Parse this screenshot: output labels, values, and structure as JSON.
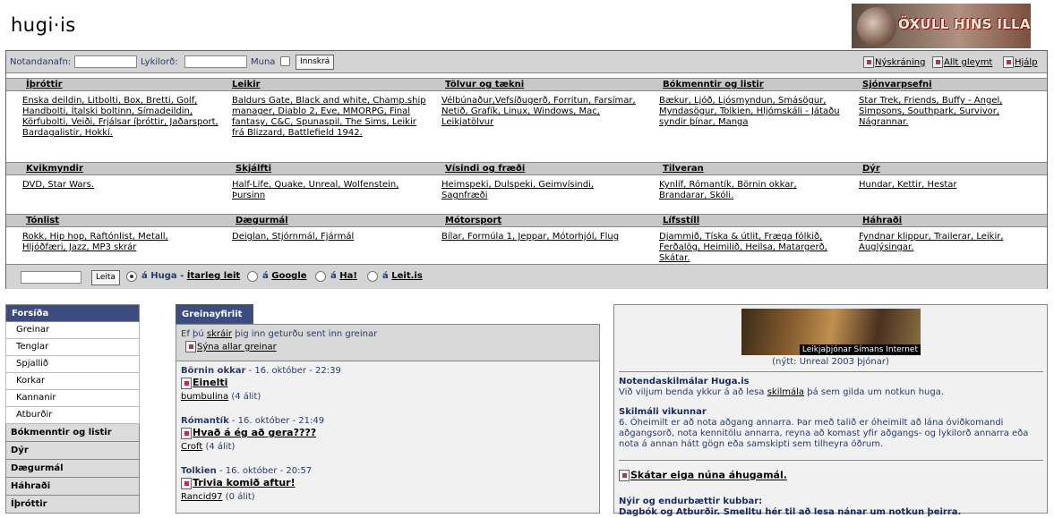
{
  "site": {
    "logo": "hugi·is",
    "banner_text": "ÖXULL HINS ILLA"
  },
  "login": {
    "username_label": "Notandanafn:",
    "password_label": "Lykilorð:",
    "remember_label": "Muna",
    "login_button": "Innskrá",
    "links": [
      "Nýskráning",
      "Allt gleymt",
      "Hjálp"
    ]
  },
  "categories": {
    "row1": [
      {
        "head": "Íþróttir",
        "body": "Enska deildin, Litbolti, Box, Bretti, Golf, Handbolti, Ítalski boltinn, Símadeildin, Körfubolti, Veiði, Frjálsar íþróttir, Jaðarsport, Bardagalistir, Hokkí."
      },
      {
        "head": "Leikir",
        "body": "Baldurs Gate, Black and white, Champ.ship manager, Diablo 2, Eve, MMORPG, Final fantasy, C&C, Spunaspil, The Sims, Leikir frá Blizzard, Battlefield 1942."
      },
      {
        "head": "Tölvur og tækni",
        "body": "Vélbúnaður,Vefsíðugerð, Forritun, Farsímar, Netið, Grafík, Linux, Windows, Mac, Leikjatölvur"
      },
      {
        "head": "Bókmenntir og listir",
        "body": "Bækur, Ljóð, Ljósmyndun, Smásögur, Myndasögur, Tolkien, Hljómskáli - Játaðu syndir þínar, Manga"
      },
      {
        "head": "Sjónvarpsefni",
        "body": "Star Trek, Friends, Buffy - Angel, Simpsons, Southpark, Survivor, Nágrannar."
      }
    ],
    "row2": [
      {
        "head": "Kvikmyndir",
        "body": "DVD, Star Wars."
      },
      {
        "head": "Skjálfti",
        "body": "Half-Life, Quake, Unreal, Wolfenstein, Þursinn"
      },
      {
        "head": "Vísindi og fræði",
        "body": "Heimspeki, Dulspeki, Geimvísindi, Sagnfræði"
      },
      {
        "head": "Tilveran",
        "body": "Kynlíf, Rómantík, Börnin okkar, Brandarar, Skóli."
      },
      {
        "head": "Dýr",
        "body": "Hundar, Kettir, Hestar"
      }
    ],
    "row3": [
      {
        "head": "Tónlist",
        "body": "Rokk, Hip hop, Raftónlist, Metall, Hljóðfæri, Jazz, MP3 skrár"
      },
      {
        "head": "Dægurmál",
        "body": "Deiglan, Stjórnmál, Fjármál"
      },
      {
        "head": "Mótorsport",
        "body": "Bílar, Formúla 1, Jeppar, Mótorhjól, Flug"
      },
      {
        "head": "Lífsstíll",
        "body": "Djammið, Tíska & útlit, Fræga fólkið, Ferðalög, Heimilið, Heilsa, Matargerð, Skátar."
      },
      {
        "head": "Háhraði",
        "body": "Fyndnar klippur, Trailerar, Leikir, Auglýsingar."
      }
    ]
  },
  "search": {
    "button": "Leita",
    "opt1_prefix": "á",
    "opt1": "Huga",
    "opt1_sep": " - ",
    "opt1_extra": "Ítarleg leit",
    "opt2_prefix": "á",
    "opt2": "Google",
    "opt3_prefix": "á",
    "opt3": "Ha!",
    "opt4_prefix": "á",
    "opt4": "Leit.is"
  },
  "sidebar": {
    "header": "Forsíða",
    "items": [
      "Greinar",
      "Tenglar",
      "Spjallið",
      "Korkar",
      "Kannanir",
      "Atburðir"
    ],
    "sections": [
      "Bókmenntir og listir",
      "Dýr",
      "Dægurmál",
      "Háhraði",
      "Íþróttir"
    ]
  },
  "articles": {
    "tab": "Greinayfirlit",
    "intro_pre": "Ef þú ",
    "intro_link": "skráir",
    "intro_post": " þig inn geturðu sent inn greinar",
    "show_all": "Sýna allar greinar",
    "list": [
      {
        "cat": "Börnin okkar",
        "date": " - 16. október - 22:39",
        "title": "Einelti",
        "author": "bumbulina",
        "count": " (4 álit)"
      },
      {
        "cat": "Rómantík",
        "date": " - 16. október - 21:49",
        "title": "Hvað á ég að gera????",
        "author": "Croft",
        "count": " (4 álit)"
      },
      {
        "cat": "Tolkien",
        "date": " - 16. október - 20:57",
        "title": "Trivia komið aftur!",
        "author": "Rancid97",
        "count": " (0 álit)"
      }
    ]
  },
  "right": {
    "promo_caption": "Leikjaþjónar Símans Internet",
    "promo_sub": "(nýtt: Unreal 2003 þjónar)",
    "terms_title": "Notendaskilmálar Huga.is",
    "terms_pre": "Við viljum benda ykkur á að lesa ",
    "terms_link": "skilmála",
    "terms_post": " þá sem gilda um notkun huga.",
    "week_title": "Skilmáli vikunnar",
    "week_body": "6. Óheimilt er að nota aðgang annarra. Þar með talið er óheimilt að lána óviðkomandi aðgangsorð, nota kennitölu annarra, reyna að komast yfir aðgangs- og lykilorð annarra eða nota á annan hátt gögn eða samskipti sem tilheyra öðrum.",
    "news_title": "Skátar eiga núna áhugamál.",
    "clubs_title": "Nýir og endurbættir kubbar:",
    "clubs_body": "Dagbók og Atburðir. Smelltu hér til að lesa nánar um notkun þeirra."
  }
}
